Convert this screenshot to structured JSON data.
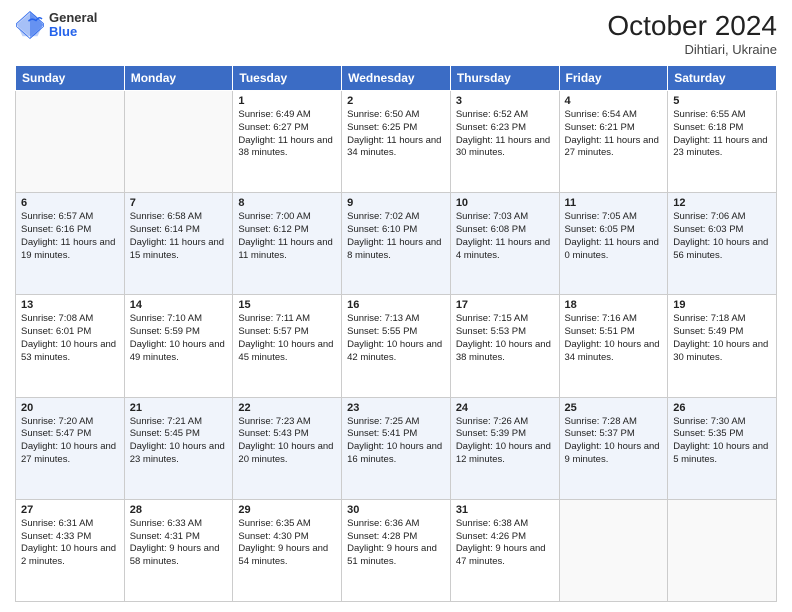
{
  "header": {
    "logo_general": "General",
    "logo_blue": "Blue",
    "month_title": "October 2024",
    "location": "Dihtiari, Ukraine"
  },
  "days_of_week": [
    "Sunday",
    "Monday",
    "Tuesday",
    "Wednesday",
    "Thursday",
    "Friday",
    "Saturday"
  ],
  "weeks": [
    [
      {
        "day": "",
        "info": ""
      },
      {
        "day": "",
        "info": ""
      },
      {
        "day": "1",
        "info": "Sunrise: 6:49 AM\nSunset: 6:27 PM\nDaylight: 11 hours and 38 minutes."
      },
      {
        "day": "2",
        "info": "Sunrise: 6:50 AM\nSunset: 6:25 PM\nDaylight: 11 hours and 34 minutes."
      },
      {
        "day": "3",
        "info": "Sunrise: 6:52 AM\nSunset: 6:23 PM\nDaylight: 11 hours and 30 minutes."
      },
      {
        "day": "4",
        "info": "Sunrise: 6:54 AM\nSunset: 6:21 PM\nDaylight: 11 hours and 27 minutes."
      },
      {
        "day": "5",
        "info": "Sunrise: 6:55 AM\nSunset: 6:18 PM\nDaylight: 11 hours and 23 minutes."
      }
    ],
    [
      {
        "day": "6",
        "info": "Sunrise: 6:57 AM\nSunset: 6:16 PM\nDaylight: 11 hours and 19 minutes."
      },
      {
        "day": "7",
        "info": "Sunrise: 6:58 AM\nSunset: 6:14 PM\nDaylight: 11 hours and 15 minutes."
      },
      {
        "day": "8",
        "info": "Sunrise: 7:00 AM\nSunset: 6:12 PM\nDaylight: 11 hours and 11 minutes."
      },
      {
        "day": "9",
        "info": "Sunrise: 7:02 AM\nSunset: 6:10 PM\nDaylight: 11 hours and 8 minutes."
      },
      {
        "day": "10",
        "info": "Sunrise: 7:03 AM\nSunset: 6:08 PM\nDaylight: 11 hours and 4 minutes."
      },
      {
        "day": "11",
        "info": "Sunrise: 7:05 AM\nSunset: 6:05 PM\nDaylight: 11 hours and 0 minutes."
      },
      {
        "day": "12",
        "info": "Sunrise: 7:06 AM\nSunset: 6:03 PM\nDaylight: 10 hours and 56 minutes."
      }
    ],
    [
      {
        "day": "13",
        "info": "Sunrise: 7:08 AM\nSunset: 6:01 PM\nDaylight: 10 hours and 53 minutes."
      },
      {
        "day": "14",
        "info": "Sunrise: 7:10 AM\nSunset: 5:59 PM\nDaylight: 10 hours and 49 minutes."
      },
      {
        "day": "15",
        "info": "Sunrise: 7:11 AM\nSunset: 5:57 PM\nDaylight: 10 hours and 45 minutes."
      },
      {
        "day": "16",
        "info": "Sunrise: 7:13 AM\nSunset: 5:55 PM\nDaylight: 10 hours and 42 minutes."
      },
      {
        "day": "17",
        "info": "Sunrise: 7:15 AM\nSunset: 5:53 PM\nDaylight: 10 hours and 38 minutes."
      },
      {
        "day": "18",
        "info": "Sunrise: 7:16 AM\nSunset: 5:51 PM\nDaylight: 10 hours and 34 minutes."
      },
      {
        "day": "19",
        "info": "Sunrise: 7:18 AM\nSunset: 5:49 PM\nDaylight: 10 hours and 30 minutes."
      }
    ],
    [
      {
        "day": "20",
        "info": "Sunrise: 7:20 AM\nSunset: 5:47 PM\nDaylight: 10 hours and 27 minutes."
      },
      {
        "day": "21",
        "info": "Sunrise: 7:21 AM\nSunset: 5:45 PM\nDaylight: 10 hours and 23 minutes."
      },
      {
        "day": "22",
        "info": "Sunrise: 7:23 AM\nSunset: 5:43 PM\nDaylight: 10 hours and 20 minutes."
      },
      {
        "day": "23",
        "info": "Sunrise: 7:25 AM\nSunset: 5:41 PM\nDaylight: 10 hours and 16 minutes."
      },
      {
        "day": "24",
        "info": "Sunrise: 7:26 AM\nSunset: 5:39 PM\nDaylight: 10 hours and 12 minutes."
      },
      {
        "day": "25",
        "info": "Sunrise: 7:28 AM\nSunset: 5:37 PM\nDaylight: 10 hours and 9 minutes."
      },
      {
        "day": "26",
        "info": "Sunrise: 7:30 AM\nSunset: 5:35 PM\nDaylight: 10 hours and 5 minutes."
      }
    ],
    [
      {
        "day": "27",
        "info": "Sunrise: 6:31 AM\nSunset: 4:33 PM\nDaylight: 10 hours and 2 minutes."
      },
      {
        "day": "28",
        "info": "Sunrise: 6:33 AM\nSunset: 4:31 PM\nDaylight: 9 hours and 58 minutes."
      },
      {
        "day": "29",
        "info": "Sunrise: 6:35 AM\nSunset: 4:30 PM\nDaylight: 9 hours and 54 minutes."
      },
      {
        "day": "30",
        "info": "Sunrise: 6:36 AM\nSunset: 4:28 PM\nDaylight: 9 hours and 51 minutes."
      },
      {
        "day": "31",
        "info": "Sunrise: 6:38 AM\nSunset: 4:26 PM\nDaylight: 9 hours and 47 minutes."
      },
      {
        "day": "",
        "info": ""
      },
      {
        "day": "",
        "info": ""
      }
    ]
  ]
}
